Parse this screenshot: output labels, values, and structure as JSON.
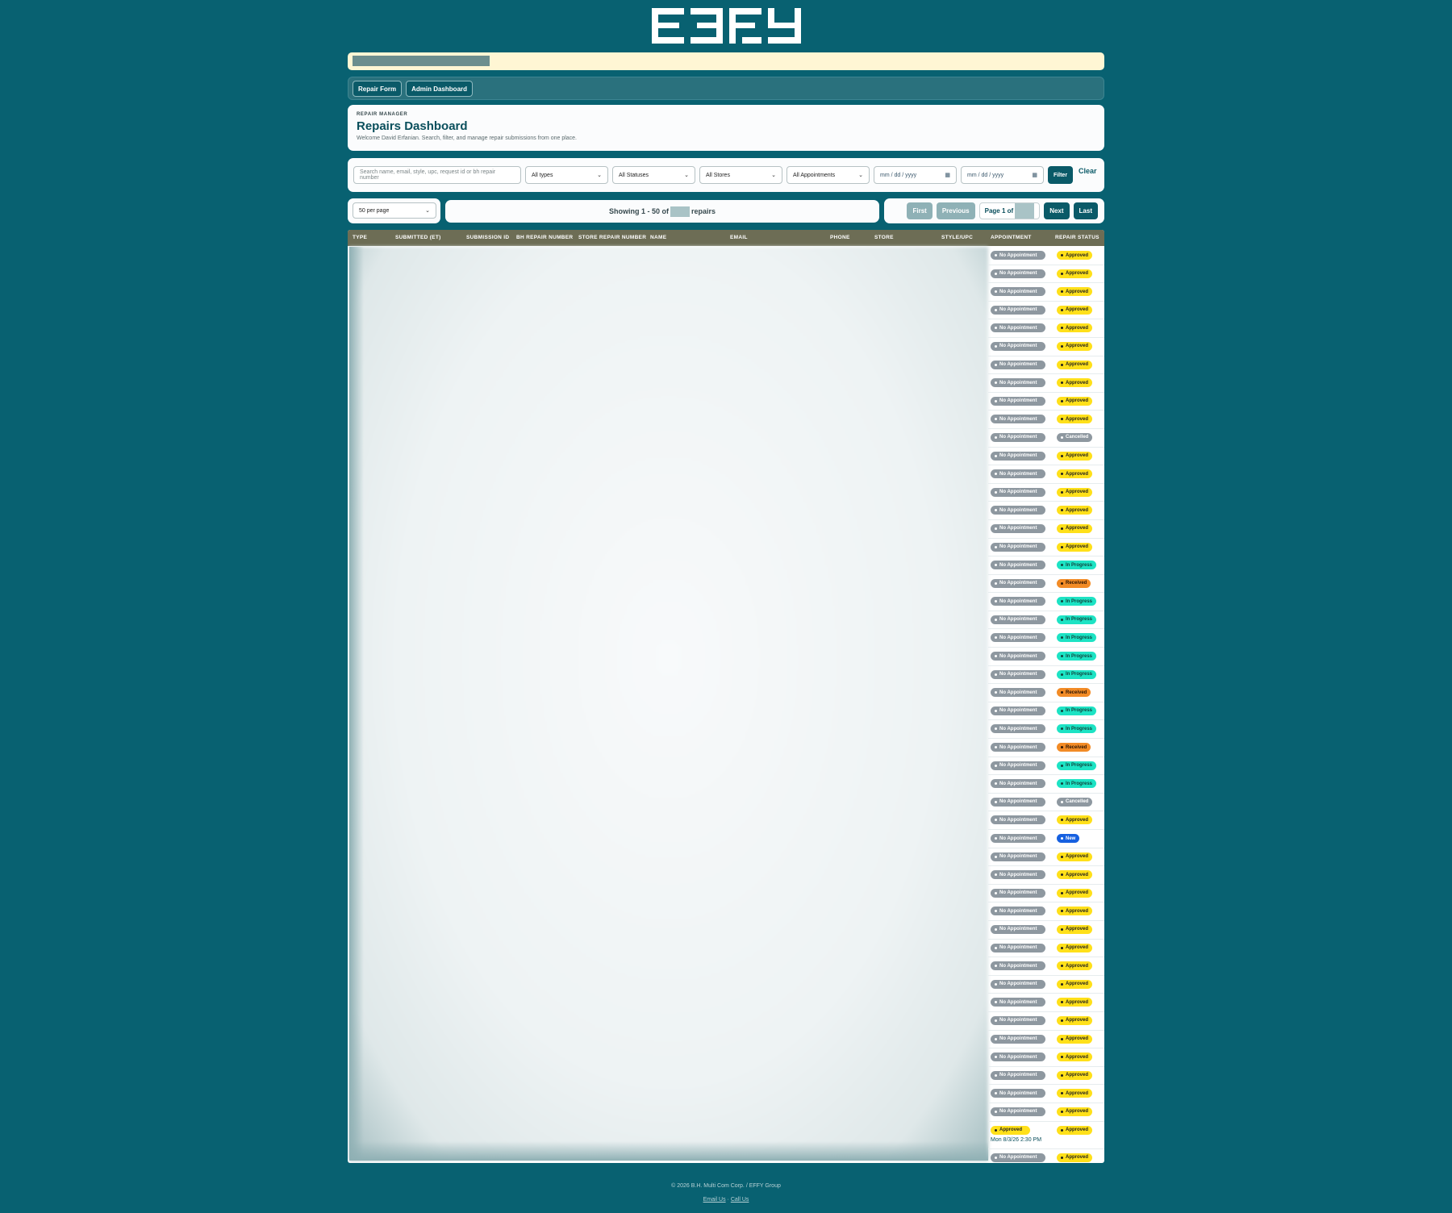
{
  "nav": {
    "repair_form": "Repair Form",
    "admin_dashboard": "Admin Dashboard"
  },
  "header": {
    "eyebrow": "REPAIR MANAGER",
    "title": "Repairs Dashboard",
    "subtitle": "Welcome David Erfanian. Search, filter, and manage repair submissions from one place."
  },
  "filters": {
    "search_placeholder": "Search name, email, style, upc, request id or bh repair number",
    "type": "All types",
    "status": "All Statuses",
    "store": "All Stores",
    "appointment": "All Appointments",
    "date_from": "mm / dd / yyyy",
    "date_to": "mm / dd / yyyy",
    "filter_label": "Filter",
    "clear_label": "Clear"
  },
  "paging": {
    "per_page": "50 per page",
    "showing_prefix": "Showing 1 - 50 of",
    "showing_suffix": "repairs",
    "first": "First",
    "previous": "Previous",
    "page_label": "Page 1 of",
    "next": "Next",
    "last": "Last"
  },
  "columns": [
    "TYPE",
    "SUBMITTED (ET)",
    "SUBMISSION ID",
    "BH REPAIR NUMBER",
    "STORE REPAIR NUMBER",
    "NAME",
    "EMAIL",
    "PHONE",
    "STORE",
    "STYLE/UPC",
    "APPOINTMENT",
    "REPAIR STATUS"
  ],
  "rows": [
    {
      "appointment": "No Appointment",
      "status": "Approved"
    },
    {
      "appointment": "No Appointment",
      "status": "Approved"
    },
    {
      "appointment": "No Appointment",
      "status": "Approved"
    },
    {
      "appointment": "No Appointment",
      "status": "Approved"
    },
    {
      "appointment": "No Appointment",
      "status": "Approved"
    },
    {
      "appointment": "No Appointment",
      "status": "Approved"
    },
    {
      "appointment": "No Appointment",
      "status": "Approved"
    },
    {
      "appointment": "No Appointment",
      "status": "Approved"
    },
    {
      "appointment": "No Appointment",
      "status": "Approved"
    },
    {
      "appointment": "No Appointment",
      "status": "Approved"
    },
    {
      "appointment": "No Appointment",
      "status": "Cancelled"
    },
    {
      "appointment": "No Appointment",
      "status": "Approved"
    },
    {
      "appointment": "No Appointment",
      "status": "Approved"
    },
    {
      "appointment": "No Appointment",
      "status": "Approved"
    },
    {
      "appointment": "No Appointment",
      "status": "Approved"
    },
    {
      "appointment": "No Appointment",
      "status": "Approved"
    },
    {
      "appointment": "No Appointment",
      "status": "Approved"
    },
    {
      "appointment": "No Appointment",
      "status": "In Progress"
    },
    {
      "appointment": "No Appointment",
      "status": "Received"
    },
    {
      "appointment": "No Appointment",
      "status": "In Progress"
    },
    {
      "appointment": "No Appointment",
      "status": "In Progress"
    },
    {
      "appointment": "No Appointment",
      "status": "In Progress"
    },
    {
      "appointment": "No Appointment",
      "status": "In Progress"
    },
    {
      "appointment": "No Appointment",
      "status": "In Progress"
    },
    {
      "appointment": "No Appointment",
      "status": "Received"
    },
    {
      "appointment": "No Appointment",
      "status": "In Progress"
    },
    {
      "appointment": "No Appointment",
      "status": "In Progress"
    },
    {
      "appointment": "No Appointment",
      "status": "Received"
    },
    {
      "appointment": "No Appointment",
      "status": "In Progress"
    },
    {
      "appointment": "No Appointment",
      "status": "In Progress"
    },
    {
      "appointment": "No Appointment",
      "status": "Cancelled"
    },
    {
      "appointment": "No Appointment",
      "status": "Approved"
    },
    {
      "appointment": "No Appointment",
      "status": "New"
    },
    {
      "appointment": "No Appointment",
      "status": "Approved"
    },
    {
      "appointment": "No Appointment",
      "status": "Approved"
    },
    {
      "appointment": "No Appointment",
      "status": "Approved"
    },
    {
      "appointment": "No Appointment",
      "status": "Approved"
    },
    {
      "appointment": "No Appointment",
      "status": "Approved"
    },
    {
      "appointment": "No Appointment",
      "status": "Approved"
    },
    {
      "appointment": "No Appointment",
      "status": "Approved"
    },
    {
      "appointment": "No Appointment",
      "status": "Approved"
    },
    {
      "appointment": "No Appointment",
      "status": "Approved"
    },
    {
      "appointment": "No Appointment",
      "status": "Approved"
    },
    {
      "appointment": "No Appointment",
      "status": "Approved"
    },
    {
      "appointment": "No Appointment",
      "status": "Approved"
    },
    {
      "appointment": "No Appointment",
      "status": "Approved"
    },
    {
      "appointment": "No Appointment",
      "status": "Approved"
    },
    {
      "appointment": "No Appointment",
      "status": "Approved"
    },
    {
      "appointment": "Approved",
      "appointment_date": "Mon 8/3/26 2:30 PM",
      "status": "Approved"
    },
    {
      "appointment": "No Appointment",
      "status": "Approved"
    }
  ],
  "footer": {
    "copyright": "© 2026 B.H. Multi Com Corp. / EFFY Group",
    "email_link": "Email Us",
    "separator": "·",
    "call_link": "Call Us"
  },
  "logo_text": "EFFY",
  "colors": {
    "background": "#086171",
    "approved": "#ffe01a",
    "in_progress": "#1de3c4",
    "received": "#f28b26",
    "cancelled": "#8e98a0",
    "new": "#1660e0"
  }
}
